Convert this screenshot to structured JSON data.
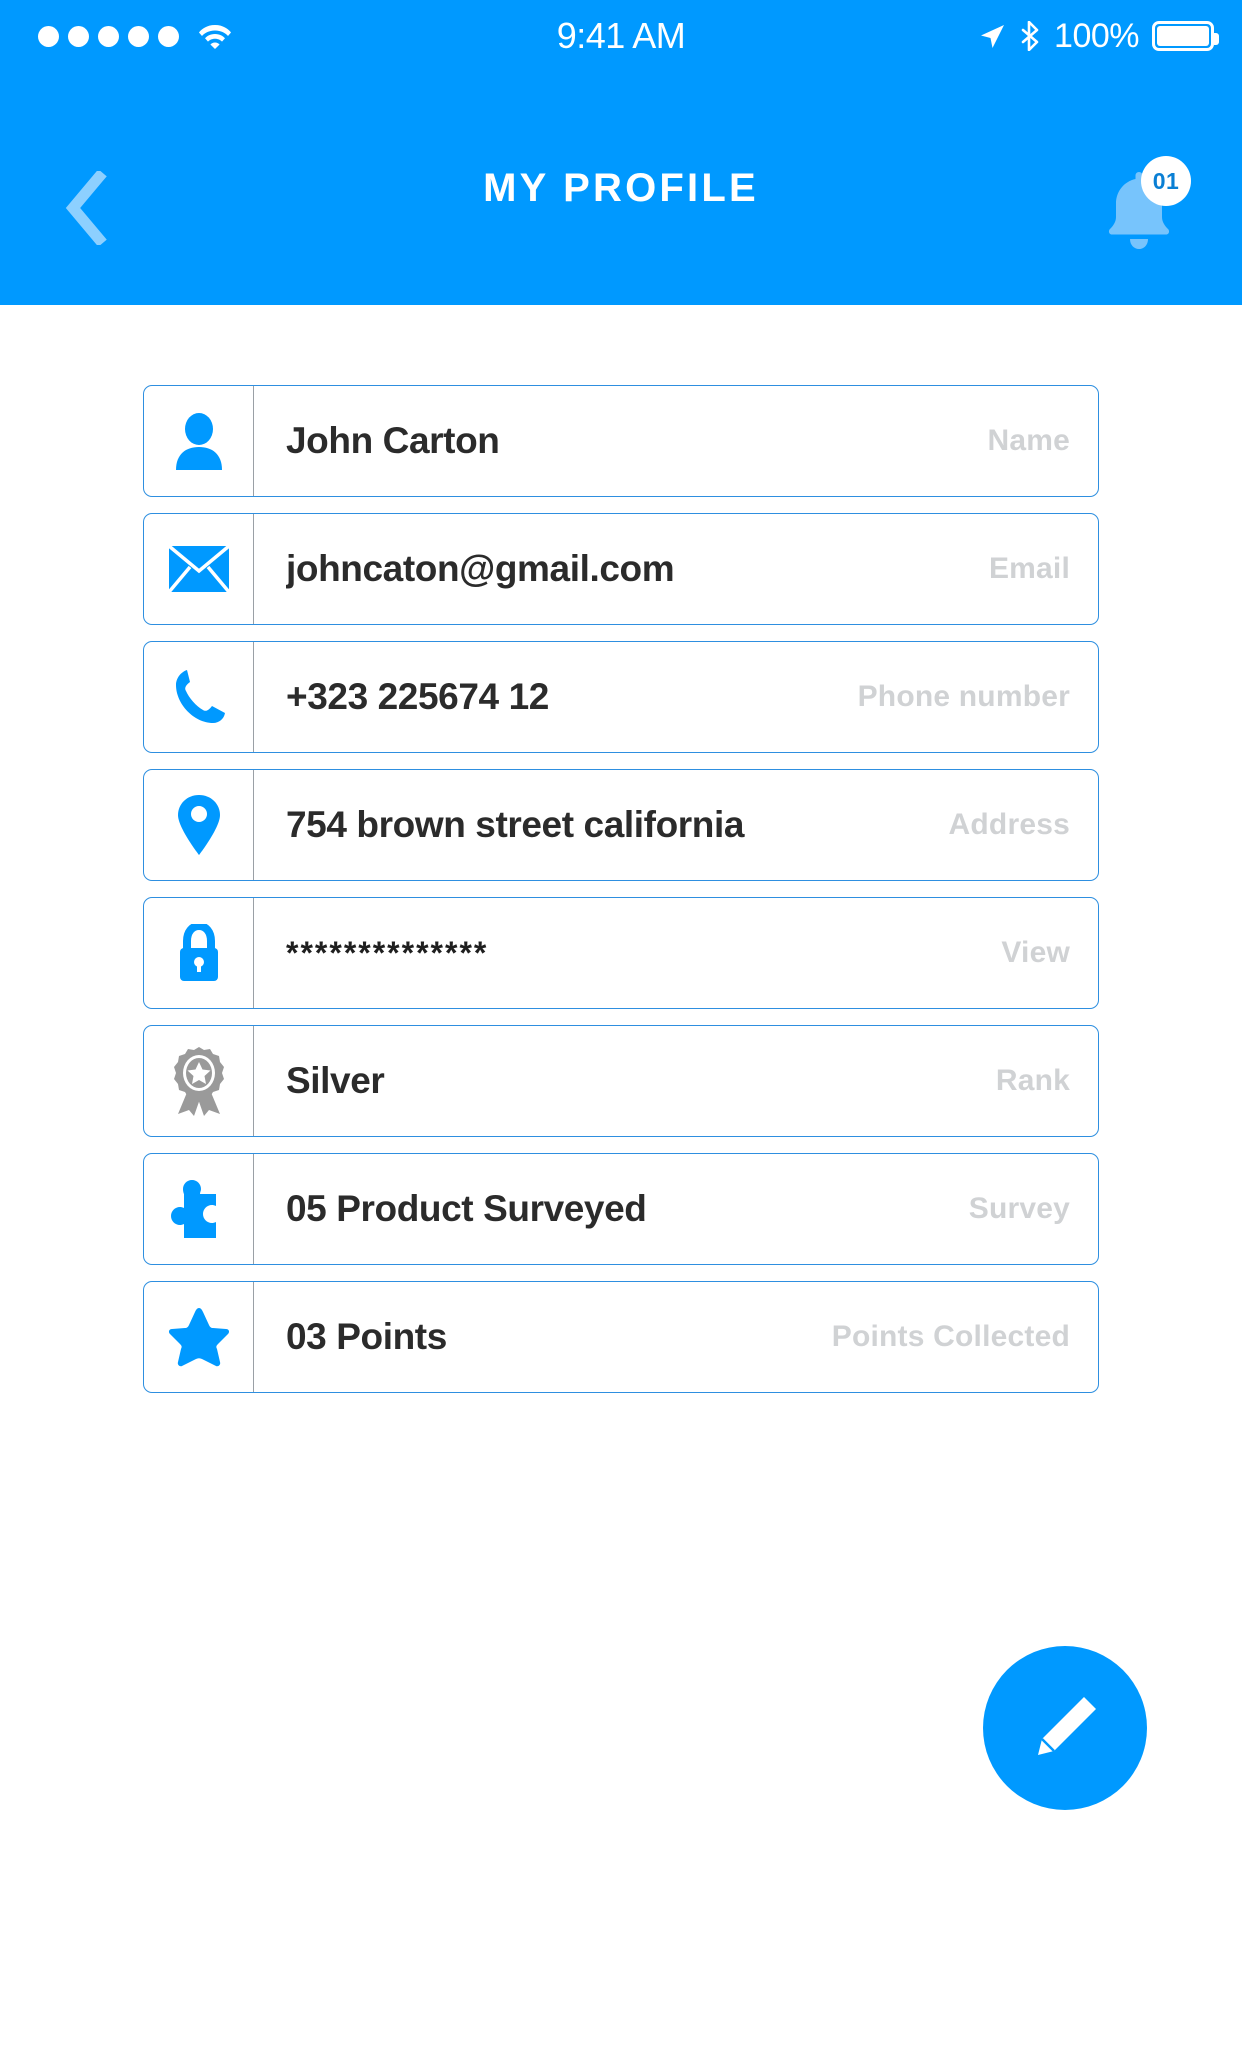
{
  "theme": {
    "brand_blue": "#0099FF",
    "card_border": "#2e8fe0",
    "label_gray": "#d0d2d4",
    "value_dark": "#2b2b2b",
    "rank_gray": "#9a9a9a"
  },
  "status_bar": {
    "signal_dots": 5,
    "wifi_icon": "wifi-icon",
    "time": "9:41 AM",
    "location_icon": "location-arrow-icon",
    "bluetooth_icon": "bluetooth-icon",
    "battery_percent": "100%",
    "battery_icon": "battery-full-icon"
  },
  "nav_bar": {
    "back_icon": "chevron-left-icon",
    "title": "MY PROFILE",
    "bell_icon": "bell-icon",
    "badge_count": "01"
  },
  "profile_rows": [
    {
      "icon": "person-icon",
      "value": "John Carton",
      "label": "Name"
    },
    {
      "icon": "envelope-icon",
      "value": "johncaton@gmail.com",
      "label": "Email"
    },
    {
      "icon": "phone-icon",
      "value": "+323 225674 12",
      "label": "Phone number"
    },
    {
      "icon": "map-pin-icon",
      "value": "754 brown street california",
      "label": "Address"
    },
    {
      "icon": "lock-icon",
      "value": "**************",
      "label": "View"
    },
    {
      "icon": "medal-icon",
      "value": "Silver",
      "label": "Rank"
    },
    {
      "icon": "puzzle-piece-icon",
      "value": "05 Product Surveyed",
      "label": "Survey"
    },
    {
      "icon": "star-icon",
      "value": "03 Points",
      "label": "Points Collected"
    }
  ],
  "fab": {
    "icon": "pencil-icon",
    "action": "edit-profile"
  }
}
